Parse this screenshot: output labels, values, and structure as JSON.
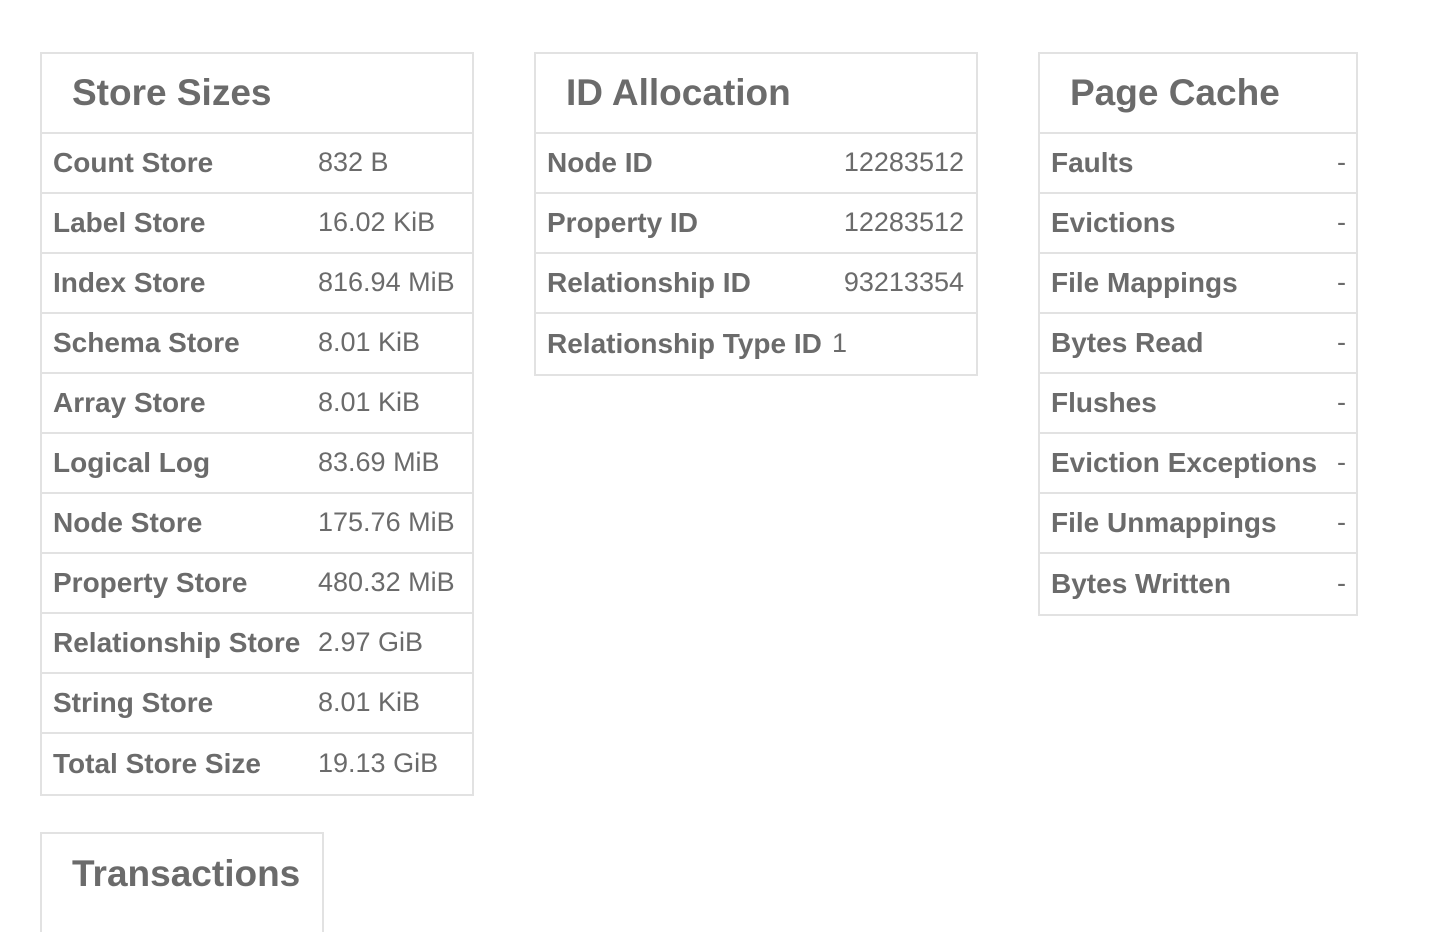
{
  "store_sizes": {
    "title": "Store Sizes",
    "rows": [
      {
        "label": "Count Store",
        "value": "832 B"
      },
      {
        "label": "Label Store",
        "value": "16.02 KiB"
      },
      {
        "label": "Index Store",
        "value": "816.94 MiB"
      },
      {
        "label": "Schema Store",
        "value": "8.01 KiB"
      },
      {
        "label": "Array Store",
        "value": "8.01 KiB"
      },
      {
        "label": "Logical Log",
        "value": "83.69 MiB"
      },
      {
        "label": "Node Store",
        "value": "175.76 MiB"
      },
      {
        "label": "Property Store",
        "value": "480.32 MiB"
      },
      {
        "label": "Relationship Store",
        "value": "2.97 GiB"
      },
      {
        "label": "String Store",
        "value": "8.01 KiB"
      },
      {
        "label": "Total Store Size",
        "value": "19.13 GiB"
      }
    ]
  },
  "id_allocation": {
    "title": "ID Allocation",
    "rows": [
      {
        "label": "Node ID",
        "value": "12283512"
      },
      {
        "label": "Property ID",
        "value": "12283512"
      },
      {
        "label": "Relationship ID",
        "value": "93213354"
      },
      {
        "label": "Relationship Type ID",
        "value": "1"
      }
    ]
  },
  "page_cache": {
    "title": "Page Cache",
    "rows": [
      {
        "label": "Faults",
        "value": "-"
      },
      {
        "label": "Evictions",
        "value": "-"
      },
      {
        "label": "File Mappings",
        "value": "-"
      },
      {
        "label": "Bytes Read",
        "value": "-"
      },
      {
        "label": "Flushes",
        "value": "-"
      },
      {
        "label": "Eviction Exceptions",
        "value": "-"
      },
      {
        "label": "File Unmappings",
        "value": "-"
      },
      {
        "label": "Bytes Written",
        "value": "-"
      }
    ]
  },
  "transactions": {
    "title": "Transactions"
  }
}
